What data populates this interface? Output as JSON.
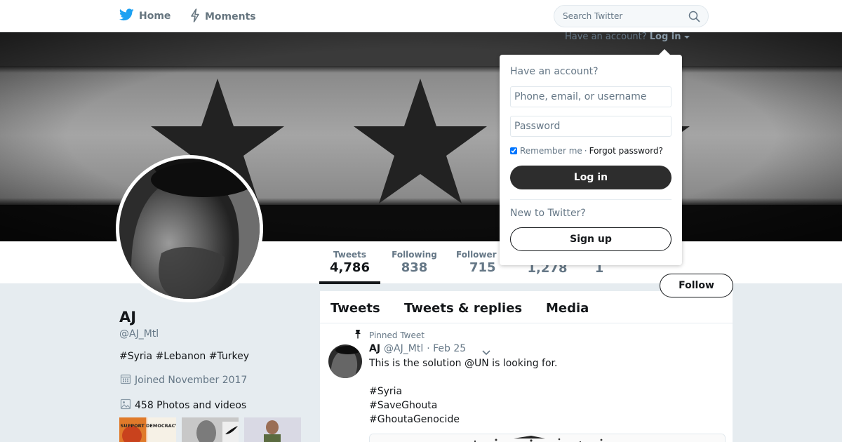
{
  "nav": {
    "home_label": "Home",
    "moments_label": "Moments",
    "search_placeholder": "Search Twitter"
  },
  "login_menu": {
    "prompt": "Have an account?",
    "trigger_label": "Log in",
    "title": "Have an account?",
    "username_placeholder": "Phone, email, or username",
    "password_placeholder": "Password",
    "remember_label": "Remember me",
    "remember_checked": true,
    "separator": "·",
    "forgot_label": "Forgot password?",
    "login_button": "Log in",
    "new_label": "New to Twitter?",
    "signup_button": "Sign up"
  },
  "stats": [
    {
      "label": "Tweets",
      "value": "4,786",
      "active": true
    },
    {
      "label": "Following",
      "value": "838"
    },
    {
      "label": "Follower",
      "value": "715"
    },
    {
      "label": "",
      "value": "1,278"
    },
    {
      "label": "",
      "value": "1"
    }
  ],
  "follow_button": "Follow",
  "profile": {
    "name": "AJ",
    "handle": "@AJ_Mtl",
    "bio": "#Syria #Lebanon #Turkey",
    "joined": "Joined November 2017",
    "photos": "458 Photos and videos"
  },
  "thumbnails": [
    {
      "text": "SUPPORT DEMOCRACY IN SYRIA"
    },
    {
      "text": ""
    },
    {
      "text": ""
    }
  ],
  "timeline": {
    "tabs": [
      "Tweets",
      "Tweets & replies",
      "Media"
    ],
    "pinned_label": "Pinned Tweet",
    "tweet": {
      "author": "AJ",
      "handle": "@AJ_Mtl",
      "date": "· Feb 25",
      "lines": [
        "This is the solution @UN is looking for.",
        "",
        "#Syria",
        "#SaveGhouta",
        "#GhoutaGenocide"
      ]
    }
  },
  "colors": {
    "page_bg": "#e6ecf0",
    "brand_blue": "#1da1f2",
    "button_dark": "#2d2d2d"
  },
  "icons": {
    "home": "twitter-bird-icon",
    "moments": "lightning-icon",
    "search": "search-icon",
    "caret": "caret-down-icon",
    "pin": "pin-icon",
    "calendar": "calendar-icon",
    "photos": "image-icon",
    "chevron": "chevron-down-icon"
  }
}
